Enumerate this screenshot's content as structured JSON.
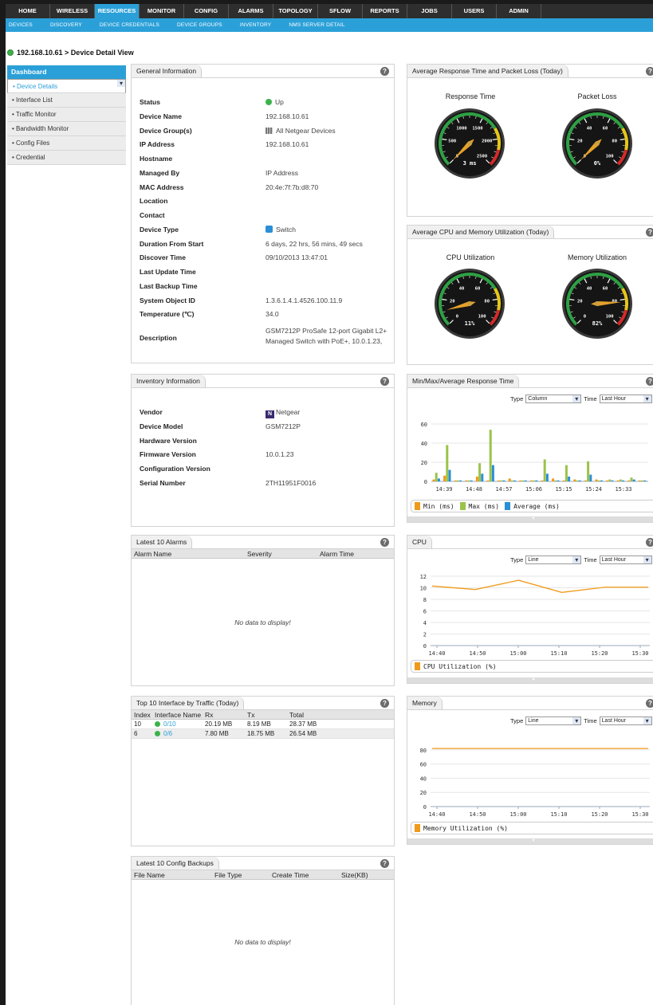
{
  "topnav": [
    "HOME",
    "WIRELESS",
    "RESOURCES",
    "MONITOR",
    "CONFIG",
    "ALARMS",
    "TOPOLOGY",
    "SFLOW",
    "REPORTS",
    "JOBS",
    "USERS",
    "ADMIN"
  ],
  "topnav_active": "RESOURCES",
  "subnav": [
    "DEVICES",
    "DISCOVERY",
    "DEVICE CREDENTIALS",
    "DEVICE GROUPS",
    "INVENTORY",
    "NMS SERVER DETAIL"
  ],
  "breadcrumb": "192.168.10.61 > Device Detail View",
  "sidebar": {
    "header": "Dashboard",
    "items": [
      "• Device Details",
      "• Interface List",
      "• Traffic Monitor",
      "• Bandwidth Monitor",
      "• Config Files",
      "• Credential"
    ]
  },
  "general": {
    "title": "General Information",
    "rows": [
      {
        "k": "Status",
        "v": "Up"
      },
      {
        "k": "Device Name",
        "v": "192.168.10.61"
      },
      {
        "k": "Device Group(s)",
        "v": "All Netgear Devices"
      },
      {
        "k": "IP Address",
        "v": "192.168.10.61"
      },
      {
        "k": "Hostname",
        "v": ""
      },
      {
        "k": "Managed By",
        "v": "IP Address"
      },
      {
        "k": "MAC Address",
        "v": "20:4e:7f:7b:d8:70"
      },
      {
        "k": "Location",
        "v": ""
      },
      {
        "k": "Contact",
        "v": ""
      },
      {
        "k": "Device Type",
        "v": "Switch"
      },
      {
        "k": "Duration From Start",
        "v": "6 days, 22 hrs, 56 mins, 49 secs"
      },
      {
        "k": "Discover Time",
        "v": "09/10/2013 13:47:01"
      },
      {
        "k": "Last Update Time",
        "v": ""
      },
      {
        "k": "Last Backup Time",
        "v": ""
      },
      {
        "k": "System Object ID",
        "v": "1.3.6.1.4.1.4526.100.11.9"
      },
      {
        "k": "Temperature (℃)",
        "v": "34.0"
      }
    ],
    "desc_label": "Description",
    "desc_line1": "GSM7212P ProSafe 12-port Gigabit L2+",
    "desc_line2": "Managed Switch with PoE+, 10.0.1.23,"
  },
  "inventory": {
    "title": "Inventory Information",
    "rows": [
      {
        "k": "Vendor",
        "v": "Netgear"
      },
      {
        "k": "Device Model",
        "v": "GSM7212P"
      },
      {
        "k": "Hardware Version",
        "v": ""
      },
      {
        "k": "Firmware Version",
        "v": "10.0.1.23"
      },
      {
        "k": "Configuration Version",
        "v": ""
      },
      {
        "k": "Serial Number",
        "v": "2TH11951F0016"
      }
    ]
  },
  "alarms": {
    "title": "Latest 10 Alarms",
    "cols": [
      "Alarm Name",
      "Severity",
      "Alarm Time"
    ],
    "empty": "No data to display!"
  },
  "top10": {
    "title": "Top 10 Interface by Traffic (Today)",
    "cols": [
      "Index",
      "Interface Name",
      "Rx",
      "Tx",
      "Total"
    ],
    "rows": [
      [
        "10",
        "0/10",
        "20.19 MB",
        "8.19 MB",
        "28.37 MB"
      ],
      [
        "6",
        "0/6",
        "7.80 MB",
        "18.75 MB",
        "26.54 MB"
      ]
    ]
  },
  "backups": {
    "title": "Latest 10 Config Backups",
    "cols": [
      "File Name",
      "File Type",
      "Create Time",
      "Size(KB)"
    ],
    "empty": "No data to display!"
  },
  "resp": {
    "title": "Average Response Time and Packet Loss (Today)",
    "g1": "Response Time",
    "g1val": "3 ms",
    "g2": "Packet Loss",
    "g2val": "0%"
  },
  "cpumem": {
    "title": "Average CPU and Memory Utilization (Today)",
    "g1": "CPU Utilization",
    "g1val": "11%",
    "g2": "Memory Utilization",
    "g2val": "82%"
  },
  "gauges": {
    "needle_color": "#e5a12a",
    "g1_ticks": [
      "500",
      "1000",
      "1500",
      "2000",
      "2500"
    ],
    "pct_ticks": [
      "20",
      "40",
      "60",
      "80",
      "100"
    ],
    "zero": "0"
  },
  "controls": {
    "type_label": "Type",
    "time_label": "Time",
    "time_value": "Last Hour"
  },
  "chart_data": [
    {
      "type": "bar",
      "title": "Min/Max/Average Response Time",
      "control_type": "Column",
      "yticks": [
        "0",
        "20",
        "40",
        "60"
      ],
      "xticks": [
        "14:39",
        "14:48",
        "14:57",
        "15:06",
        "15:15",
        "15:24",
        "15:33"
      ],
      "ylim": [
        0,
        70
      ],
      "series": [
        {
          "name": "Min (ms)",
          "color": "#f09a1a",
          "values": [
            2,
            6,
            1,
            1,
            5,
            1,
            1,
            3,
            1,
            1,
            1,
            3,
            1,
            2,
            1,
            2,
            1,
            1,
            1,
            1
          ]
        },
        {
          "name": "Max (ms)",
          "color": "#9ac34a",
          "values": [
            9,
            38,
            1,
            1,
            19,
            54,
            1,
            1,
            1,
            1,
            23,
            1,
            17,
            1,
            21,
            1,
            2,
            2,
            4,
            1
          ]
        },
        {
          "name": "Average (ms)",
          "color": "#2b8fd6",
          "values": [
            3,
            12,
            1,
            1,
            8,
            17,
            1,
            1,
            1,
            1,
            8,
            1,
            5,
            1,
            7,
            1,
            1,
            1,
            2,
            1
          ]
        }
      ]
    },
    {
      "type": "line",
      "title": "CPU",
      "control_type": "Line",
      "yticks": [
        "0",
        "2",
        "4",
        "6",
        "8",
        "10",
        "12"
      ],
      "xticks": [
        "14:40",
        "14:50",
        "15:00",
        "15:10",
        "15:20",
        "15:30"
      ],
      "ylim": [
        0,
        12
      ],
      "series": [
        {
          "name": "CPU Utilization (%)",
          "color": "#f09a1a",
          "values": [
            10.3,
            9.7,
            11.3,
            9.2,
            10.1,
            10.1
          ]
        }
      ]
    },
    {
      "type": "line",
      "title": "Memory",
      "control_type": "Line",
      "yticks": [
        "0",
        "20",
        "40",
        "60",
        "80"
      ],
      "xticks": [
        "14:40",
        "14:50",
        "15:00",
        "15:10",
        "15:20",
        "15:30"
      ],
      "ylim": [
        0,
        90
      ],
      "series": [
        {
          "name": "Memory Utilization (%)",
          "color": "#f09a1a",
          "values": [
            82,
            82,
            82,
            82,
            82,
            82
          ]
        }
      ]
    }
  ]
}
